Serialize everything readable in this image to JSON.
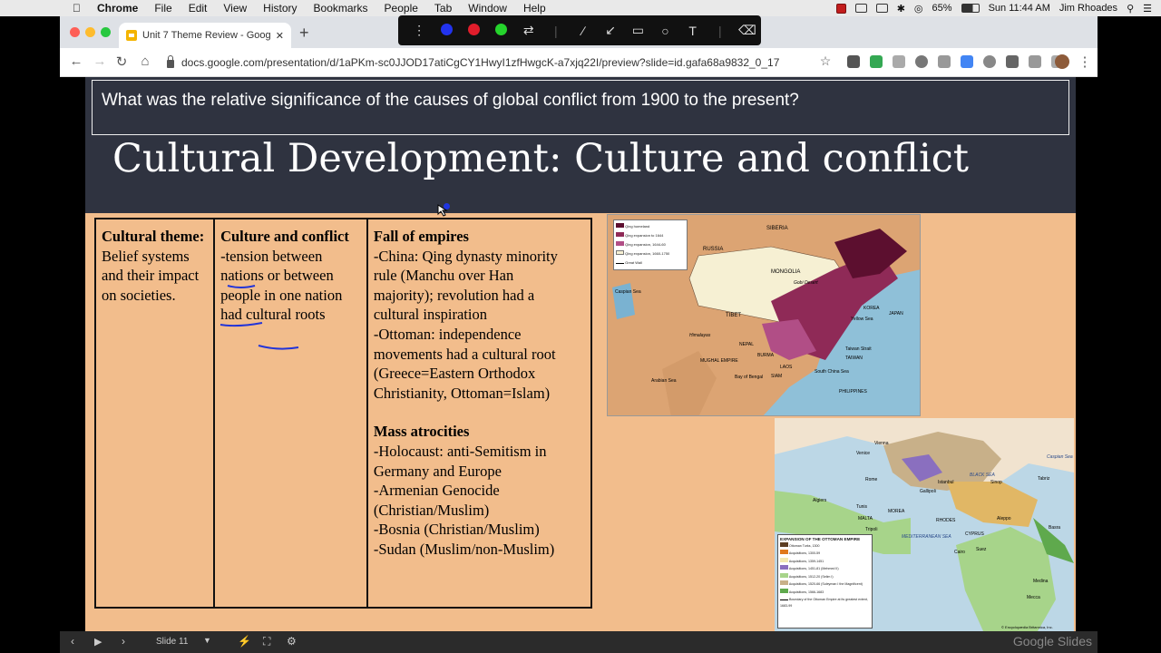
{
  "menubar": {
    "app": "Chrome",
    "items": [
      "File",
      "Edit",
      "View",
      "History",
      "Bookmarks",
      "People",
      "Tab",
      "Window",
      "Help"
    ],
    "battery": "65%",
    "clock": "Sun 11:44 AM",
    "user": "Jim Rhoades"
  },
  "browser": {
    "tab_title": "Unit 7 Theme Review - Google",
    "url": "docs.google.com/presentation/d/1aPKm-sc0JJOD17atiCgCY1HwyI1zfHwgcK-a7xjq22I/preview?slide=id.gafa68a9832_0_17"
  },
  "slide": {
    "question": "What was the relative significance of the causes of global conflict from 1900 to the present?",
    "title": "Cultural Development: Culture and conflict",
    "col1": {
      "heading": "Cultural theme:",
      "body": "Belief systems and their impact on societies."
    },
    "col2": {
      "heading": "Culture and conflict",
      "lines": [
        "-tension between",
        "nations or between",
        "people in one nation",
        "had cultural roots"
      ]
    },
    "col3": {
      "heading1": "Fall of empires",
      "lines1": [
        "-China: Qing dynasty minority",
        "rule (Manchu over Han",
        "majority); revolution had a",
        "cultural inspiration",
        "-Ottoman: independence",
        "movements had a cultural root",
        "(Greece=Eastern Orthodox",
        "Christianity, Ottoman=Islam)"
      ],
      "heading2": "Mass atrocities",
      "lines2": [
        "-Holocaust: anti-Semitism in",
        "Germany and Europe",
        "-Armenian Genocide",
        "(Christian/Muslim)",
        "-Bosnia (Christian/Muslim)",
        "-Sudan (Muslim/non-Muslim)"
      ]
    },
    "map1": {
      "legend": [
        "Qing homeland",
        "Qing expansion to 1644",
        "Qing expansion, 1644-60",
        "Qing expansion, 1660-1750",
        "Great Wall"
      ],
      "labels": [
        "SIBERIA",
        "RUSSIA",
        "MONGOLIA",
        "Gobi Desert",
        "TIBET",
        "KOREA",
        "JAPAN",
        "Caspian Sea",
        "NEPAL",
        "BURMA",
        "MUGHAL EMPIRE",
        "Arabian Sea",
        "Bay of Bengal",
        "LAOS",
        "SIAM",
        "South China Sea",
        "PHILIPPINES",
        "TAIWAN",
        "Taiwan Strait",
        "Yellow Sea",
        "Himalayas"
      ]
    },
    "map2": {
      "legend_title": "EXPANSION OF THE OTTOMAN EMPIRE",
      "legend": [
        "Ottoman Turks, 1300",
        "Acquisitions, 1300-59",
        "Acquisitions, 1359-1451",
        "Acquisitions, 1451-81 (Mehmed II)",
        "Acquisitions, 1512-20 (Selim I)",
        "Acquisitions, 1520-66 (Suleyman I the Magnificent)",
        "Acquisitions, 1566-1683",
        "Boundary of the Ottoman Empire at its greatest extent, 1683-99"
      ],
      "labels": [
        "Vienna",
        "Venice",
        "Rome",
        "Algiers",
        "Tunis",
        "Tripoli",
        "MALTA",
        "MOREA",
        "Istanbul",
        "BLACK SEA",
        "Sinop",
        "Tabriz",
        "Aleppo",
        "RHODES",
        "CYPRUS",
        "Cairo",
        "Suez",
        "Medina",
        "Mecca",
        "Basra",
        "MEDITERRANEAN SEA",
        "Caspian Sea",
        "Gallipoli"
      ],
      "credit": "© Encyclopædia Britannica, Inc."
    }
  },
  "bottombar": {
    "slide_label": "Slide 11",
    "brand": "Google Slides"
  }
}
